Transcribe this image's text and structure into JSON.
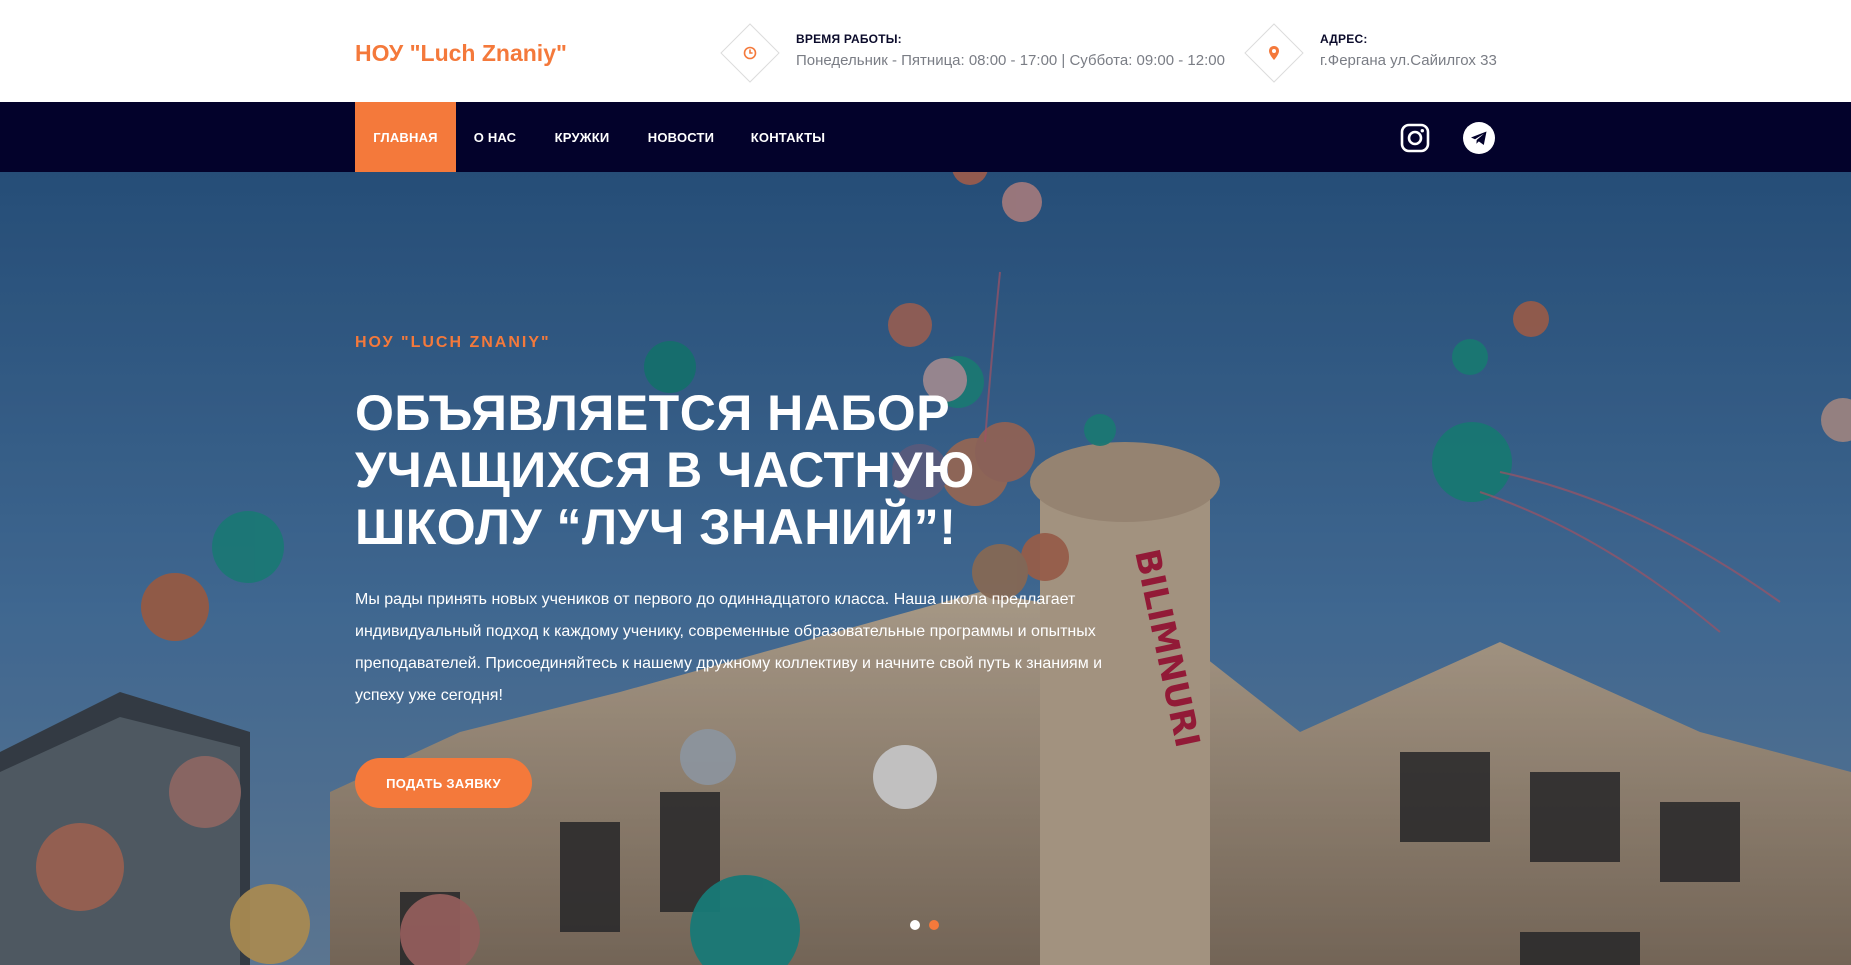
{
  "header": {
    "brand": "НОУ \"Luch Znaniy\"",
    "hours": {
      "title": "ВРЕМЯ РАБОТЫ:",
      "value": "Понедельник - Пятница: 08:00 - 17:00 | Суббота: 09:00 - 12:00",
      "icon": "clock-icon"
    },
    "address": {
      "title": "АДРЕС:",
      "value": "г.Фергана ул.Сайилгох 33",
      "icon": "map-pin-icon"
    }
  },
  "nav": {
    "items": [
      {
        "label": "ГЛАВНАЯ",
        "active": true
      },
      {
        "label": "О НАС",
        "active": false
      },
      {
        "label": "КРУЖКИ",
        "active": false
      },
      {
        "label": "НОВОСТИ",
        "active": false
      },
      {
        "label": "КОНТАКТЫ",
        "active": false
      }
    ],
    "social": [
      "instagram-icon",
      "telegram-icon"
    ]
  },
  "hero": {
    "eyebrow": "НОУ \"LUCH ZNANIY\"",
    "title": "ОБЪЯВЛЯЕТСЯ НАБОР УЧАЩИХСЯ В ЧАСТНУЮ ШКОЛУ “ЛУЧ ЗНАНИЙ”!",
    "description": "Мы рады принять новых учеников от первого до одиннадцатого класса. Наша школа предлагает индивидуальный подход к каждому ученику, современные образовательные программы и опытных преподавателей. Присоединяйтесь к нашему дружному коллективу и начните свой путь к знаниям и успеху уже сегодня!",
    "button": "ПОДАТЬ ЗАЯВКУ",
    "slides_total": 2,
    "active_slide": 2
  },
  "colors": {
    "accent": "#f4793b",
    "nav_bg": "#03022b",
    "text_dark": "#0b0b2b",
    "text_muted": "#7a7d85"
  }
}
